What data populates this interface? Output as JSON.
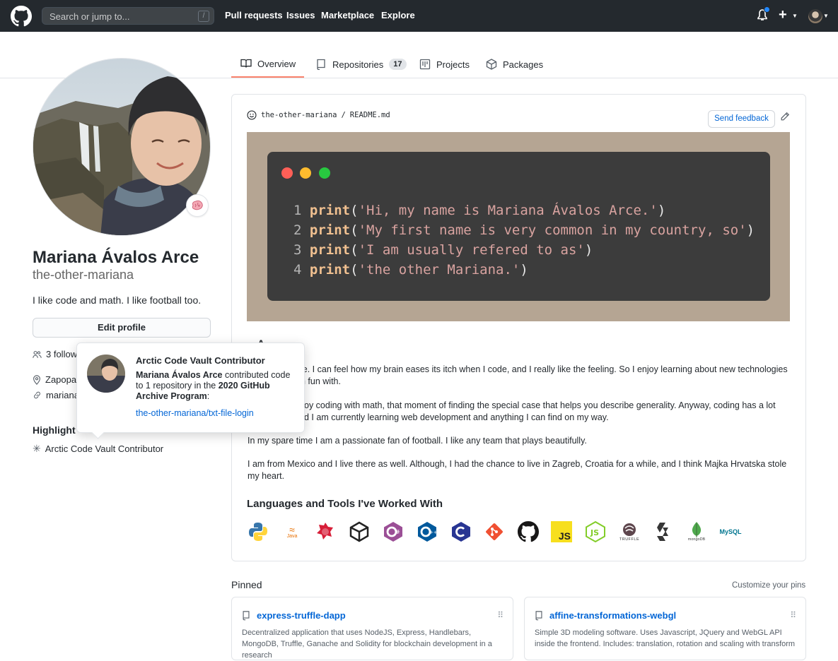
{
  "header": {
    "search_placeholder": "Search or jump to...",
    "search_key": "/",
    "nav": [
      "Pull requests",
      "Issues",
      "Marketplace",
      "Explore"
    ],
    "plus": "+"
  },
  "tabs": [
    {
      "label": "Overview",
      "icon": "book-icon"
    },
    {
      "label": "Repositories",
      "icon": "repo-icon",
      "count": "17"
    },
    {
      "label": "Projects",
      "icon": "project-icon"
    },
    {
      "label": "Packages",
      "icon": "package-icon"
    }
  ],
  "profile": {
    "name": "Mariana Ávalos Arce",
    "login": "the-other-mariana",
    "bio": "I like code and math. I like football too.",
    "edit_label": "Edit profile",
    "followers_partial": "3 follow",
    "location_partial": "Zapopa",
    "link_partial": "mariana",
    "highlights_label": "Highlight",
    "highlight_item": "Arctic Code Vault Contributor"
  },
  "popover": {
    "title": "Arctic Code Vault Contributor",
    "name_bold": "Mariana Ávalos Arce",
    "body_1": " contributed code to 1 repository in the ",
    "program_bold": "2020 GitHub Archive Program",
    "body_2": ":",
    "link": "the-other-mariana/txt-file-login"
  },
  "readme": {
    "owner": "the-other-mariana",
    "sep": "/",
    "file": "README.md",
    "feedback_label": "Send feedback",
    "code": [
      {
        "n": "1",
        "fn": "print",
        "open": "(",
        "str": "'Hi, my name is Mariana Ávalos Arce.'",
        "close": ")"
      },
      {
        "n": "2",
        "fn": "print",
        "open": "(",
        "str": "'My first name is very common in my country, so'",
        "close": ")"
      },
      {
        "n": "3",
        "fn": "print",
        "open": "(",
        "str": "'I am usually refered to as'",
        "close": ")"
      },
      {
        "n": "4",
        "fn": "print",
        "open": "(",
        "str": "'the other Mariana.'",
        "close": ")"
      }
    ],
    "heading_partial": "A",
    "p1a": "le. I can feel how my brain eases its itch when I code, and I really like the feeling. So I enjoy learning about new technologies",
    "p1b": "n fun with.",
    "p2a": "oy coding with math, that moment of finding the special case that helps you describe generality. Anyway, coding has a lot",
    "p2b": "d I am currently learning web development and anything I can find on my way.",
    "p3": "In my spare time I am a passionate fan of football. I like any team that plays beautifully.",
    "p4": "I am from Mexico and I live there as well. Although, I had the chance to live in Zagreb, Croatia for a while, and I think Majka Hrvatska stole my heart.",
    "languages_title": "Languages and Tools I've Worked With",
    "tools": [
      "python-icon",
      "java-icon",
      "nestjs-icon",
      "unity-icon",
      "csharp-icon",
      "cplusplus-icon",
      "c-icon",
      "git-icon",
      "github-icon",
      "javascript-icon",
      "nodejs-icon",
      "truffle-icon",
      "solidity-icon",
      "mongodb-icon",
      "mysql-icon"
    ],
    "tool_labels": {
      "java": "Java",
      "js": "JS",
      "truffle": "TRUFFLE",
      "mongodb": "mongoDB",
      "mysql": "MySQL"
    }
  },
  "pinned": {
    "label": "Pinned",
    "customize": "Customize your pins",
    "cards": [
      {
        "title": "express-truffle-dapp",
        "desc": "Decentralized application that uses NodeJS, Express, Handlebars, MongoDB, Truffle, Ganache and Solidity for blockchain development in a research"
      },
      {
        "title": "affine-transformations-webgl",
        "desc": "Simple 3D modeling software. Uses Javascript, JQuery and WebGL API inside the frontend. Includes: translation, rotation and scaling with transform"
      }
    ]
  },
  "colors": {
    "header": "#24292e",
    "link": "#0366d6",
    "tab_underline": "#f9826c",
    "readme_bg": "#b5a593",
    "terminal": "#3c3c3c"
  }
}
